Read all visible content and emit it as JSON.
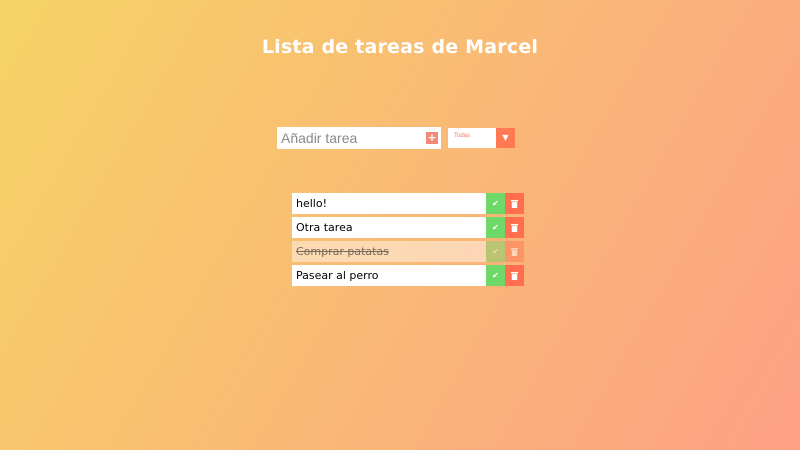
{
  "header": {
    "title": "Lista de tareas de Marcel"
  },
  "form": {
    "input_placeholder": "Añadir tarea",
    "add_icon": "plus-icon",
    "filter": {
      "selected": "Todas",
      "icon": "caret-down-icon"
    }
  },
  "todos": [
    {
      "text": "hello!",
      "completed": false
    },
    {
      "text": "Otra tarea",
      "completed": false
    },
    {
      "text": "Comprar patatas",
      "completed": true
    },
    {
      "text": "Pasear al perro",
      "completed": false
    }
  ],
  "colors": {
    "gradient_start": "#f6d365",
    "gradient_end": "#fda085",
    "check": "#6fd86a",
    "trash": "#ff6f4f",
    "accent": "#ff7a52"
  }
}
